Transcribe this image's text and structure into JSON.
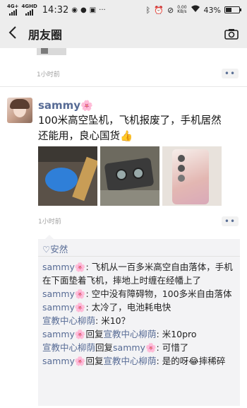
{
  "status": {
    "network_1": "4G+",
    "network_2": "4GHD",
    "time": "14:32",
    "speed_value": "0.00",
    "speed_unit": "KB/s",
    "battery": "43%",
    "battery_level": 0.43
  },
  "nav": {
    "title": "朋友圈",
    "back_icon": "chevron-left-icon",
    "camera_icon": "camera-icon"
  },
  "prev_post": {
    "time": "1小时前",
    "more_label": "••"
  },
  "post": {
    "username": "sammy",
    "name_emoji": "🌸",
    "text": "100米高空坠机，飞机报废了，手机居然还能用，良心国货👍",
    "time": "1小时前",
    "more_label": "••",
    "likes": "♡安然",
    "comments": [
      {
        "name": "sammy🌸",
        "sep": ": ",
        "text": "飞机从一百多米高空自由落体，手机在下面垫着飞机，摔地上时缠在经幡上了"
      },
      {
        "name": "sammy🌸",
        "sep": ": ",
        "text": "空中没有障碍物，100多米自由落体"
      },
      {
        "name": "sammy🌸",
        "sep": ": ",
        "text": "太冷了，电池耗电快"
      },
      {
        "name": "宣教中心柳荫",
        "sep": ": ",
        "text": "米10？"
      },
      {
        "name": "sammy🌸",
        "mid": "回复",
        "target": "宣教中心柳荫",
        "sep": ": ",
        "text": "米10pro"
      },
      {
        "name": "宣教中心柳荫",
        "mid": "回复",
        "target": "sammy🌸",
        "sep": ": ",
        "text": "可惜了"
      },
      {
        "name": "sammy🌸",
        "mid": "回复",
        "target": "宣教中心柳荫",
        "sep": ": ",
        "text": "是的呀😂摔稀碎"
      }
    ]
  },
  "colors": {
    "link": "#576b95",
    "bar_bg": "#ededed",
    "comment_bg": "#f3f3f5"
  }
}
